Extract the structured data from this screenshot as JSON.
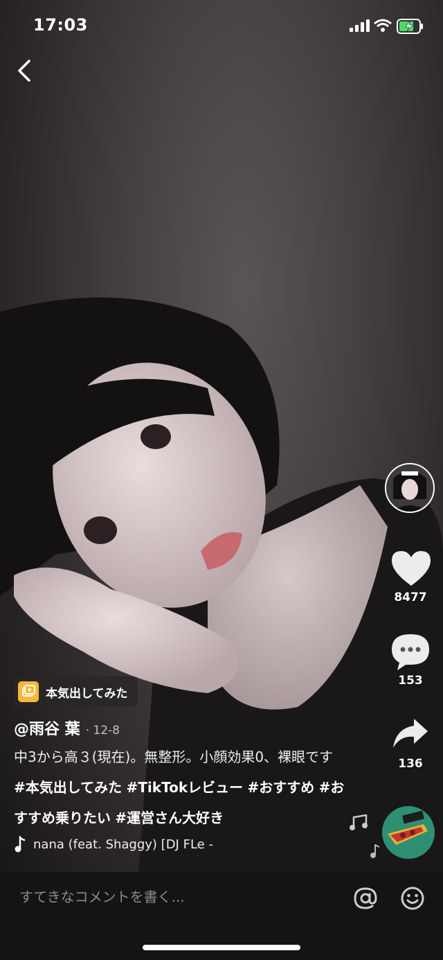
{
  "status_bar": {
    "time": "17:03"
  },
  "effect": {
    "label": "本気出してみた"
  },
  "post": {
    "username": "@雨谷 葉",
    "date": "· 12-8",
    "caption_text": "中3から高３(現在)。無整形。小顔効果0、裸眼です",
    "hashtags": [
      "#本気出してみた",
      "#TikTokレビュー",
      "#おすすめ",
      "#おすすめ乗りたい",
      "#運営さん大好き"
    ],
    "music": "nana (feat. Shaggy) [DJ FLe -"
  },
  "actions": {
    "likes": "8477",
    "comments": "153",
    "shares": "136"
  },
  "comment_box": {
    "placeholder": "すてきなコメントを書く..."
  },
  "icons": {
    "back": "chevron-left-icon",
    "like": "heart-icon",
    "comment": "speech-bubble-icon",
    "share": "share-arrow-icon",
    "music": "music-note-icon",
    "mention": "at-sign-icon",
    "emoji": "emoji-icon"
  },
  "colors": {
    "accent": "#f5b83a",
    "comment_bar": "#141414"
  }
}
